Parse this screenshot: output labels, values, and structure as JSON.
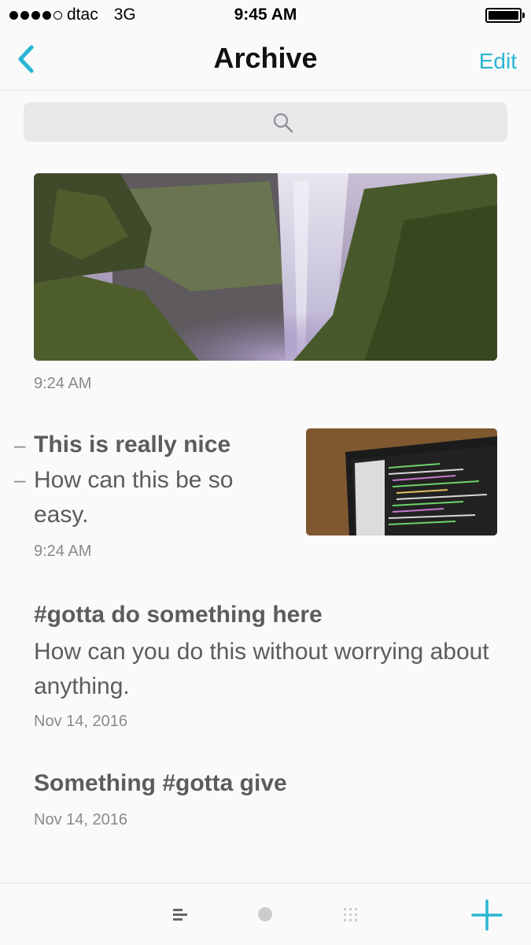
{
  "status_bar": {
    "carrier": "dtac",
    "network": "3G",
    "time": "9:45 AM"
  },
  "nav": {
    "title": "Archive",
    "edit_label": "Edit",
    "accent_color": "#29b6d3"
  },
  "search": {
    "icon": "search-icon"
  },
  "entries": [
    {
      "type": "photo",
      "photo": "waterfall-photo",
      "time": "9:24 AM"
    },
    {
      "type": "note-with-thumb",
      "title": "This is really nice",
      "body": "How can this be so easy.",
      "thumbnail": "code-monitor-photo",
      "time": "9:24 AM"
    },
    {
      "type": "note",
      "title": "#gotta do something here",
      "body": "How can you do this without worrying about anything.",
      "time": "Nov 14, 2016"
    },
    {
      "type": "note",
      "title": "Something #gotta give",
      "time": "Nov 14, 2016"
    }
  ],
  "tab_bar": {
    "tabs": [
      "list-icon",
      "dot-icon",
      "grid-icon"
    ],
    "add_icon": "plus-icon"
  }
}
